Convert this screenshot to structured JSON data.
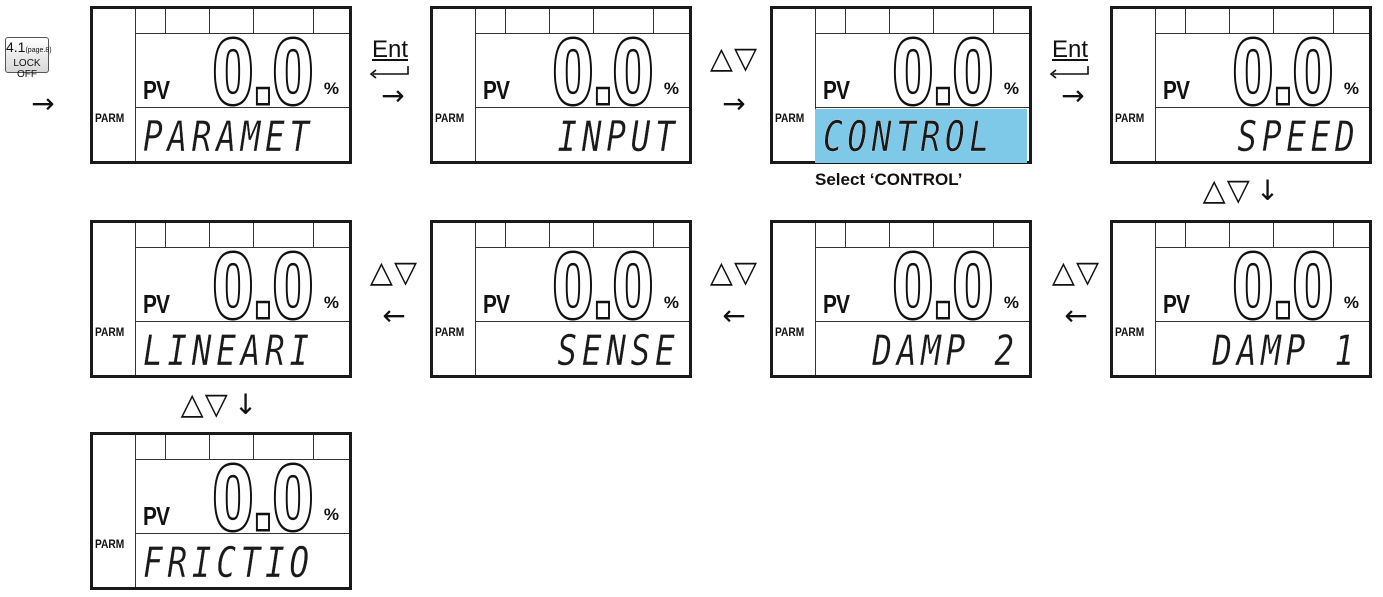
{
  "start": {
    "ref_number": "4.1",
    "ref_page": "(page.8)",
    "label": "LOCK OFF"
  },
  "symbols": {
    "arrow_right": "→",
    "arrow_left": "←",
    "arrow_down": "↓",
    "up_down": "△▽",
    "ent": "Ent"
  },
  "lcd_common": {
    "pv": "PV",
    "value": "0.0",
    "unit": "%",
    "parm": "PARM"
  },
  "screens": [
    {
      "menu": "PARAMET",
      "highlight": false
    },
    {
      "menu": "INPUT",
      "highlight": false
    },
    {
      "menu": "CONTROL",
      "highlight": true
    },
    {
      "menu": "SPEED",
      "highlight": false
    },
    {
      "menu": "DAMP 1",
      "highlight": false
    },
    {
      "menu": "DAMP 2",
      "highlight": false
    },
    {
      "menu": "SENSE",
      "highlight": false
    },
    {
      "menu": "LINEARI",
      "highlight": false
    },
    {
      "menu": "FRICTIO",
      "highlight": false
    }
  ],
  "caption": "Select ‘CONTROL’",
  "colors": {
    "highlight": "#7ec8e8",
    "lcd_border": "#1a1a1a"
  }
}
